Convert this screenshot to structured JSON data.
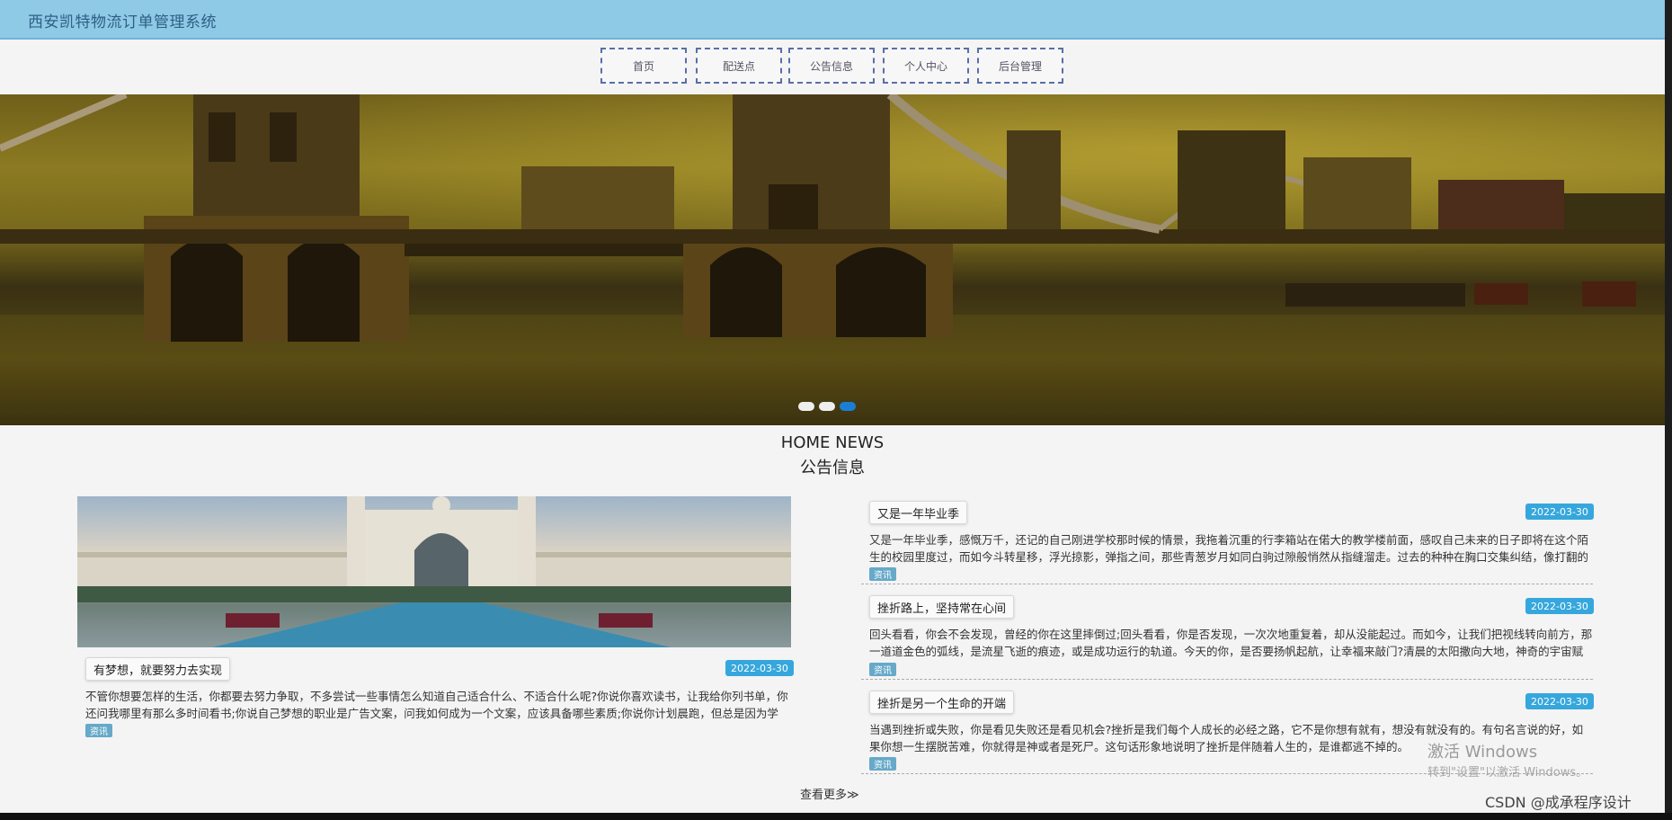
{
  "header": {
    "title": "西安凯特物流订单管理系统"
  },
  "nav": [
    {
      "label": "首页"
    },
    {
      "label": "配送点"
    },
    {
      "label": "公告信息"
    },
    {
      "label": "个人中心"
    },
    {
      "label": "后台管理"
    }
  ],
  "carousel": {
    "slide_count": 3,
    "active_index": 2
  },
  "section": {
    "title_en": "HOME NEWS",
    "title_cn": "公告信息"
  },
  "featured": {
    "title": "有梦想，就要努力去实现",
    "date": "2022-03-30",
    "excerpt": "不管你想要怎样的生活，你都要去努力争取，不多尝试一些事情怎么知道自己适合什么、不适合什么呢?你说你喜欢读书，让我给你列书单，你还问我哪里有那么多时间看书;你说自己梦想的职业是广告文案，问我如何成为一个文案，应该具备哪些素质;你说你计划晨跑，但总是因为学习、工作...",
    "tag": "资讯"
  },
  "news": [
    {
      "title": "又是一年毕业季",
      "date": "2022-03-30",
      "excerpt": "又是一年毕业季，感慨万千，还记的自己刚进学校那时候的情景，我拖着沉重的行李箱站在偌大的教学楼前面，感叹自己未来的日子即将在这个陌生的校园里度过，而如今斗转星移，浮光掠影，弹指之间，那些青葱岁月如同白驹过隙般悄然从指缝溜走。过去的种种在胸口交集纠结，像打翻的五味...",
      "tag": "资讯"
    },
    {
      "title": "挫折路上，坚持常在心间",
      "date": "2022-03-30",
      "excerpt": "回头看看，你会不会发现，曾经的你在这里摔倒过;回头看看，你是否发现，一次次地重复着，却从没能起过。而如今，让我们把视线转向前方，那一道道金色的弧线，是流星飞逝的痕迹，或是成功运行的轨道。今天的你，是否要扬帆起航，让幸福来敲门?清晨的太阳撒向大地，神奇的宇宙赋予它...",
      "tag": "资讯"
    },
    {
      "title": "挫折是另一个生命的开端",
      "date": "2022-03-30",
      "excerpt": "当遇到挫折或失败，你是看见失败还是看见机会?挫折是我们每个人成长的必经之路，它不是你想有就有，想没有就没有的。有句名言说的好，如果你想一生摆脱苦难，你就得是神或者是死尸。这句话形象地说明了挫折是伴随着人生的，是谁都逃不掉的。",
      "tag": "资讯"
    }
  ],
  "more_label": "查看更多≫",
  "overlay": {
    "activate_title": "激活 Windows",
    "activate_sub": "转到\"设置\"以激活 Windows。",
    "csdn": "CSDN @成承程序设计"
  }
}
